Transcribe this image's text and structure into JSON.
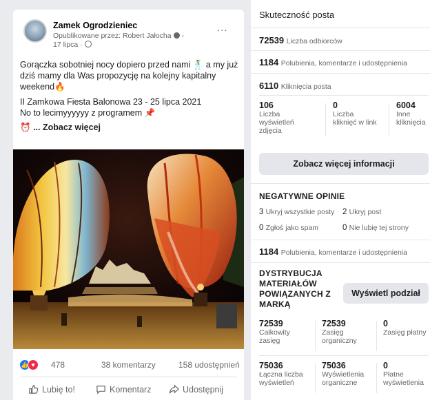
{
  "post": {
    "page_name": "Zamek Ogrodzieniec",
    "published_by": "Opublikowane przez: Robert Jałocha",
    "date": "17 lipca",
    "more": "...",
    "text_line1": "Gorączka sobotniej nocy dopiero przed nami 🕺 a my już dziś mamy dla Was propozycję na kolejny kapitalny weekend🔥",
    "text_line2": "II Zamkowa Fiesta Balonowa 23 - 25 lipca 2021",
    "text_line3": "No to lecimyyyyyy z programem 📌",
    "see_more": "... Zobacz więcej",
    "reactions_count": "478",
    "comments": "38 komentarzy",
    "shares": "158 udostępnień",
    "actions": {
      "like": "Lubię to!",
      "comment": "Komentarz",
      "share": "Udostępnij"
    }
  },
  "insights": {
    "title": "Skuteczność posta",
    "reach": {
      "value": "72539",
      "label": "Liczba odbiorców"
    },
    "engagement": {
      "value": "1184",
      "label": "Polubienia, komentarze i udostępnienia"
    },
    "clicks": {
      "value": "6110",
      "label": "Kliknięcia posta"
    },
    "click_breakdown": [
      {
        "value": "106",
        "label": "Liczba wyświetleń zdjęcia"
      },
      {
        "value": "0",
        "label": "Liczba kliknięć w link"
      },
      {
        "value": "6004",
        "label": "Inne kliknięcia"
      }
    ],
    "more_info_button": "Zobacz więcej informacji",
    "negative": {
      "title": "NEGATYWNE OPINIE",
      "items": [
        {
          "value": "3",
          "label": "Ukryj wszystkie posty"
        },
        {
          "value": "2",
          "label": "Ukryj post"
        },
        {
          "value": "0",
          "label": "Zgłoś jako spam"
        },
        {
          "value": "0",
          "label": "Nie lubię tej strony"
        }
      ]
    },
    "engagement2": {
      "value": "1184",
      "label": "Polubienia, komentarze i udostępnienia"
    },
    "branded": {
      "title": "DYSTRYBUCJA MATERIAŁÓW POWIĄZANYCH Z MARKĄ",
      "button": "Wyświetl podział",
      "row1": [
        {
          "value": "72539",
          "label": "Całkowity zasięg"
        },
        {
          "value": "72539",
          "label": "Zasięg organiczny"
        },
        {
          "value": "0",
          "label": "Zasięg płatny"
        }
      ],
      "row2": [
        {
          "value": "75036",
          "label": "Łączna liczba wyświetleń"
        },
        {
          "value": "75036",
          "label": "Wyświetlenia organiczne"
        },
        {
          "value": "0",
          "label": "Płatne wyświetlenia"
        }
      ]
    }
  }
}
